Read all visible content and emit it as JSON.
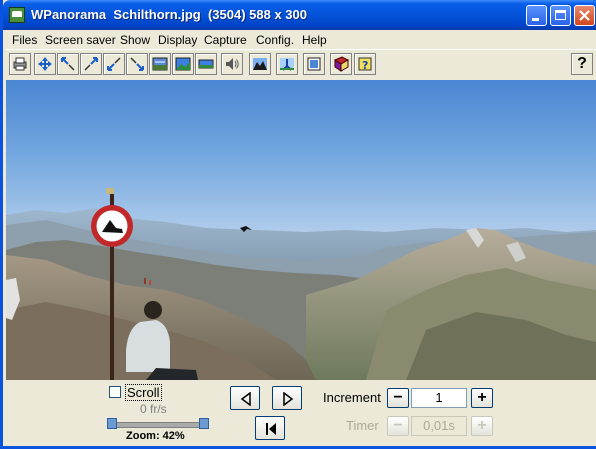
{
  "window": {
    "title": "WPanorama  Schilthorn.jpg  (3504) 588 x 300"
  },
  "menu": {
    "items": [
      "Files",
      "Screen saver",
      "Show",
      "Display",
      "Capture",
      "Config.",
      "Help"
    ]
  },
  "toolbar": {
    "icons": [
      "print-icon",
      "move-icon",
      "zoom-out-icon",
      "zoom-in-icon",
      "fit-icon",
      "expand-icon",
      "image-size-icon",
      "landscape-icon",
      "stretch-icon",
      "sound-icon",
      "mountain-icon",
      "tripod-icon",
      "frame-icon",
      "book-icon",
      "help-book-icon"
    ],
    "help_label": "?"
  },
  "controls": {
    "scroll_label": "Scroll",
    "scroll_checked": false,
    "fps_label": "0 fr/s",
    "zoom_label": "Zoom: 42%",
    "zoom_value": 0.42,
    "increment_label": "Increment",
    "increment_value": "1",
    "timer_label": "Timer",
    "timer_value": "0,01s",
    "minus": "−",
    "plus": "+"
  },
  "colors": {
    "titlebar": "#0453d8",
    "sky_top": "#4a86d3",
    "sign_red": "#c0282a"
  }
}
